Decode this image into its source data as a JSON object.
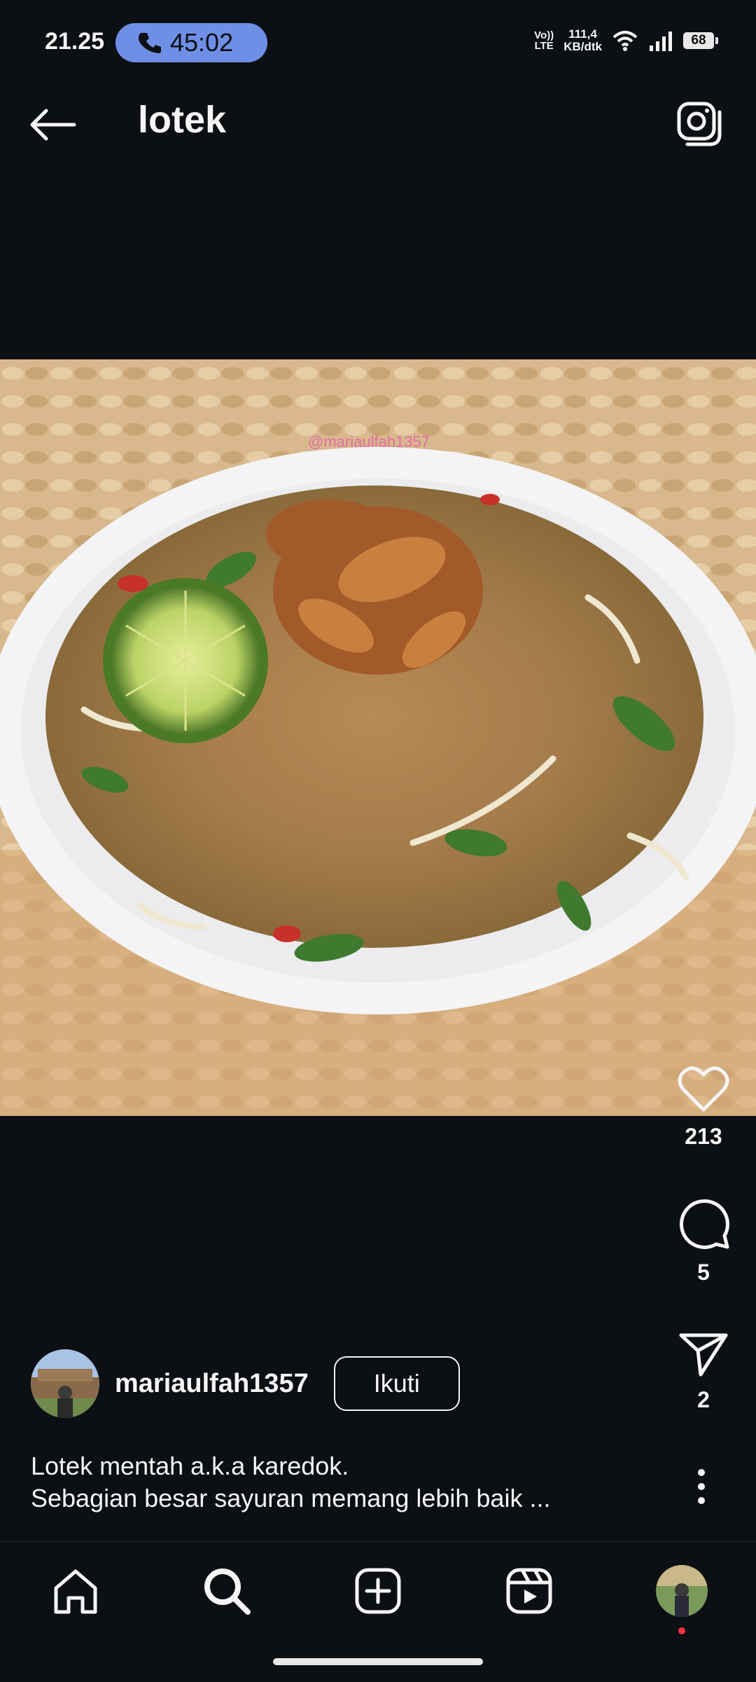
{
  "status": {
    "time": "21.25",
    "call_duration": "45:02",
    "volte": [
      "Vo))",
      "LTE"
    ],
    "net_speed": [
      "111,4",
      "KB/dtk"
    ],
    "battery": "68"
  },
  "header": {
    "title": "lotek",
    "back_icon": "arrow-left-icon",
    "camera_icon": "camera-icon"
  },
  "post": {
    "image_watermark": "@mariaulfah1357",
    "likes": "213",
    "comments": "5",
    "shares": "2",
    "author": "mariaulfah1357",
    "follow_label": "Ikuti",
    "caption_line1": "Lotek mentah a.k.a karedok.",
    "caption_line2": "Sebagian besar sayuran memang lebih baik ..."
  },
  "nav": {
    "items": [
      "home-icon",
      "search-icon",
      "add-post-icon",
      "reels-icon",
      "profile-avatar"
    ],
    "active": "search-icon"
  },
  "colors": {
    "background": "#0c1014",
    "call_pill": "#6f8fe6",
    "watermark": "#e36fa6",
    "notification_dot": "#ff3040"
  }
}
